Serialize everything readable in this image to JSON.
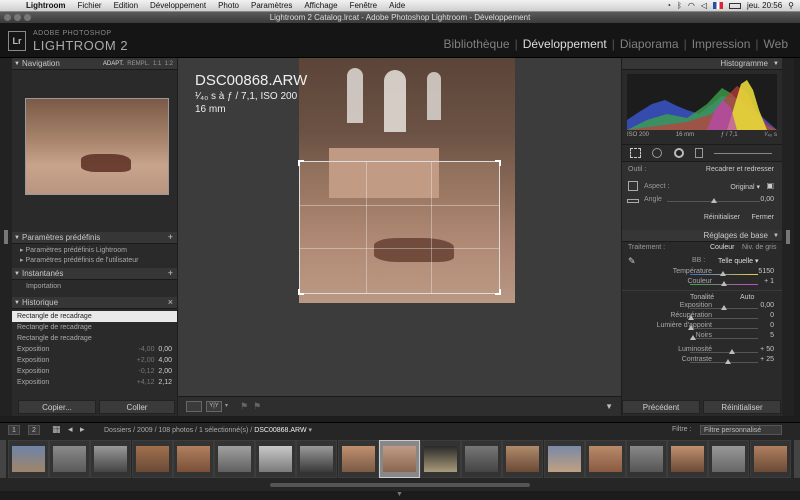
{
  "menubar": {
    "apple": "",
    "items": [
      "Lightroom",
      "Fichier",
      "Edition",
      "Développement",
      "Photo",
      "Paramètres",
      "Affichage",
      "Fenêtre",
      "Aide"
    ],
    "clock": "jeu. 20:56"
  },
  "window_title": "Lightroom 2 Catalog.lrcat - Adobe Photoshop Lightroom - Développement",
  "brand": {
    "line1": "ADOBE PHOTOSHOP",
    "line2": "LIGHTROOM 2",
    "logo": "Lr"
  },
  "modules": [
    {
      "label": "Bibliothèque",
      "active": false
    },
    {
      "label": "Développement",
      "active": true
    },
    {
      "label": "Diaporama",
      "active": false
    },
    {
      "label": "Impression",
      "active": false
    },
    {
      "label": "Web",
      "active": false
    }
  ],
  "navigator": {
    "title": "Navigation",
    "options": [
      "ADAPT.",
      "REMPL.",
      "1:1",
      "1:2"
    ]
  },
  "presets": {
    "title": "Paramètres prédéfinis",
    "items": [
      "Paramètres prédéfinis Lightroom",
      "Paramètres prédéfinis de l'utilisateur"
    ]
  },
  "snapshots": {
    "title": "Instantanés",
    "items": [
      "Importation"
    ]
  },
  "history": {
    "title": "Historique",
    "items": [
      {
        "label": "Rectangle de recadrage",
        "a": "",
        "b": "",
        "selected": true
      },
      {
        "label": "Rectangle de recadrage",
        "a": "",
        "b": "",
        "selected": false
      },
      {
        "label": "Rectangle de recadrage",
        "a": "",
        "b": "",
        "selected": false
      },
      {
        "label": "Exposition",
        "a": "-4,00",
        "b": "0,00",
        "selected": false
      },
      {
        "label": "Exposition",
        "a": "+2,00",
        "b": "4,00",
        "selected": false
      },
      {
        "label": "Exposition",
        "a": "-0,12",
        "b": "2,00",
        "selected": false
      },
      {
        "label": "Exposition",
        "a": "+4,12",
        "b": "2,12",
        "selected": false
      }
    ]
  },
  "left_buttons": {
    "copy": "Copier...",
    "paste": "Coller"
  },
  "photo_info": {
    "filename": "DSC00868.ARW",
    "exposure": "¹⁄₄₀ s à ƒ / 7,1, ISO 200",
    "focal": "16 mm"
  },
  "histogram": {
    "title": "Histogramme",
    "iso": "ISO 200",
    "focal": "16 mm",
    "aperture": "ƒ / 7,1",
    "shutter": "¹⁄₄₀ s"
  },
  "crop_tool": {
    "tool_label": "Outil :",
    "tool_name": "Recadrer et redresser",
    "aspect_label": "Aspect :",
    "aspect_value": "Original",
    "angle_label": "Angle",
    "angle_value": "0,00",
    "reset": "Réinitialiser",
    "close": "Fermer",
    "angle_level": 0.5
  },
  "basic": {
    "title": "Réglages de base",
    "treatment_label": "Traitement :",
    "color": "Couleur",
    "bw": "Niv. de gris",
    "wb_label": "BB :",
    "wb_value": "Telle quelle",
    "tone": "Tonalité",
    "auto": "Auto",
    "sliders": [
      {
        "label": "Température",
        "value": "5150",
        "level": 0.48,
        "group": "wb"
      },
      {
        "label": "Couleur",
        "value": "+ 1",
        "level": 0.5,
        "group": "wb"
      },
      {
        "label": "Exposition",
        "value": "0,00",
        "level": 0.5,
        "group": "tone"
      },
      {
        "label": "Récupération",
        "value": "0",
        "level": 0.02,
        "group": "tone"
      },
      {
        "label": "Lumière d'appoint",
        "value": "0",
        "level": 0.02,
        "group": "tone"
      },
      {
        "label": "Noirs",
        "value": "5",
        "level": 0.05,
        "group": "tone"
      },
      {
        "label": "Luminosité",
        "value": "+ 50",
        "level": 0.62,
        "group": "pres"
      },
      {
        "label": "Contraste",
        "value": "+ 25",
        "level": 0.56,
        "group": "pres"
      }
    ]
  },
  "right_buttons": {
    "previous": "Précédent",
    "reset": "Réinitialiser"
  },
  "filmstrip_bar": {
    "page1": "1",
    "page2": "2",
    "path": "Dossiers / 2009 / 108 photos / 1 sélectionné(s) /",
    "current": "DSC00868.ARW",
    "filter_label": "Filtre :",
    "filter_value": "Filtre personnalisé"
  },
  "colors": {
    "accent": "#dedede",
    "panel": "#2a2a2a",
    "bg": "#1d1d1d"
  }
}
